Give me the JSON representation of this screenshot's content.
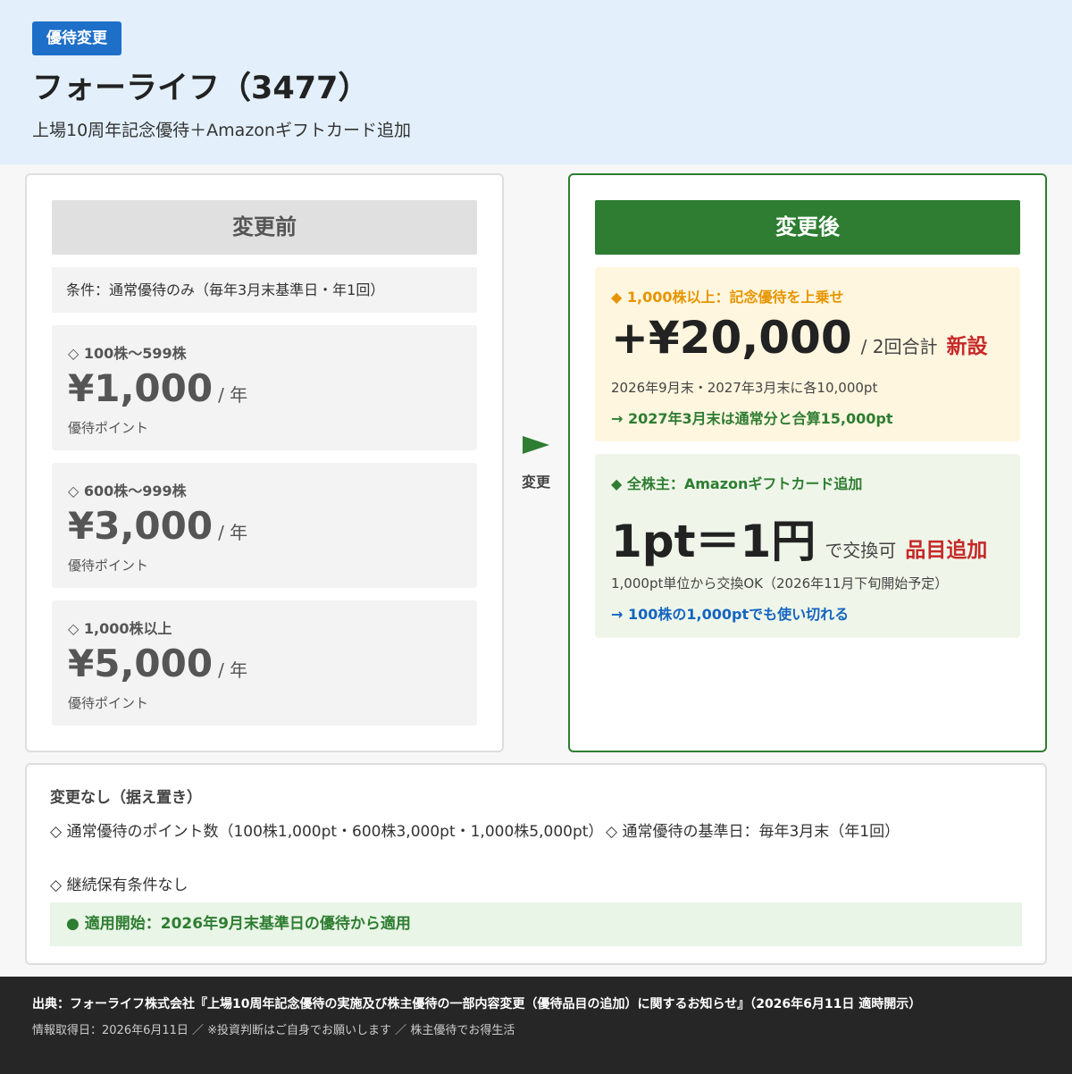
{
  "header": {
    "badge": "優待変更",
    "title": "フォーライフ（3477）",
    "subtitle": "上場10周年記念優待＋Amazonギフトカード追加"
  },
  "before": {
    "heading": "変更前",
    "condition": "条件：通常優待のみ（毎年3月末基準日・年1回）",
    "tiers": [
      {
        "label": "◇ 100株〜599株",
        "amount": "¥1,000",
        "unit": "/ 年",
        "sub": "優待ポイント"
      },
      {
        "label": "◇ 600株〜999株",
        "amount": "¥3,000",
        "unit": "/ 年",
        "sub": "優待ポイント"
      },
      {
        "label": "◇ 1,000株以上",
        "amount": "¥5,000",
        "unit": "/ 年",
        "sub": "優待ポイント"
      }
    ]
  },
  "arrow": {
    "label": "変更"
  },
  "after": {
    "heading": "変更後",
    "commemorative": {
      "label": "◆ 1,000株以上：記念優待を上乗せ",
      "amount": "+¥20,000",
      "unit": "/ 2回合計",
      "tag": "新設",
      "note": "2026年9月末・2027年3月末に各10,000pt",
      "arrow_note": "→ 2027年3月末は通常分と合算15,000pt"
    },
    "amazon": {
      "label": "◆ 全株主：Amazonギフトカード追加",
      "amount": "1pt＝1円",
      "unit": "で交換可",
      "tag": "品目追加",
      "note": "1,000pt単位から交換OK（2026年11月下旬開始予定）",
      "arrow_note": "→ 100株の1,000ptでも使い切れる"
    }
  },
  "unchanged": {
    "title": "変更なし（据え置き）",
    "items": [
      "◇ 通常優待のポイント数（100株1,000pt・600株3,000pt・1,000株5,000pt）",
      "◇ 通常優待の基準日：毎年3月末（年1回）",
      "◇ 継続保有条件なし"
    ],
    "apply": "● 適用開始：2026年9月末基準日の優待から適用"
  },
  "footer": {
    "source": "出典：フォーライフ株式会社『上場10周年記念優待の実施及び株主優待の一部内容変更（優待品目の追加）に関するお知らせ』（2026年6月11日 適時開示）",
    "info": "情報取得日：2026年6月11日 ／ ※投資判断はご自身でお願いします ／ 株主優待でお得生活"
  },
  "colors": {
    "accent_blue": "#1e6fc8",
    "accent_green": "#2e7d32",
    "accent_orange": "#e69500",
    "tag_red": "#c62828",
    "link_blue": "#1565c0"
  }
}
